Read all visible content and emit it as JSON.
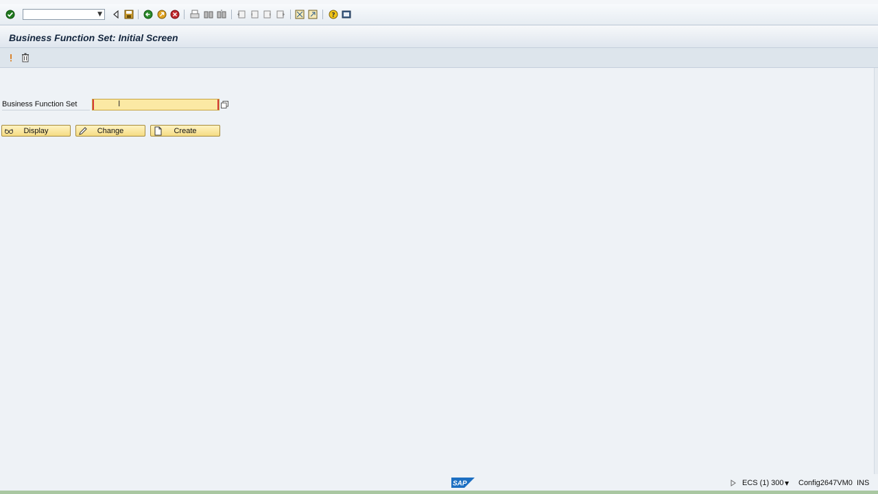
{
  "screen_title": "Business Function Set: Initial Screen",
  "field": {
    "label": "Business Function Set",
    "value": ""
  },
  "buttons": {
    "display": "Display",
    "change": "Change",
    "create": "Create"
  },
  "status_bar": {
    "system": "ECS (1) 300",
    "server": "Config2647VM0",
    "mode": "INS",
    "logo": "SAP"
  },
  "icons": {
    "toolbar": [
      "enter-icon",
      "back-icon",
      "save-icon",
      "back-nav-icon",
      "exit-icon",
      "cancel-icon",
      "print-icon",
      "find-icon",
      "find-next-icon",
      "first-page-icon",
      "prev-page-icon",
      "next-page-icon",
      "last-page-icon",
      "new-session-icon",
      "shortcut-icon",
      "help-icon",
      "customize-layout-icon"
    ],
    "app_toolbar": [
      "activate-icon",
      "delete-icon"
    ]
  },
  "colors": {
    "background": "#eef2f6",
    "input_bg": "#fbe9a4",
    "button_bg": "#f5dc83",
    "title_text": "#14263e"
  }
}
